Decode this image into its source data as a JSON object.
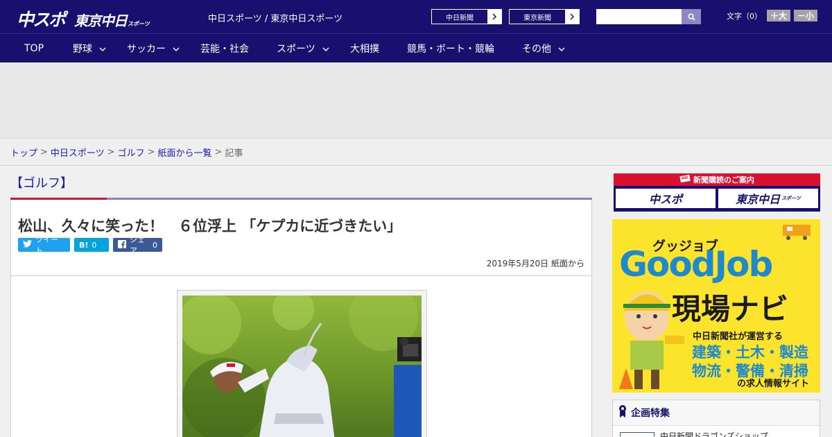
{
  "header": {
    "logo_main": "中スポ",
    "logo_sub": "東京中日",
    "logo_sub_small": "スポーツ",
    "site_name": "中日スポーツ / 東京中日スポーツ",
    "paper_links": [
      "中日新聞",
      "東京新聞"
    ],
    "search_placeholder": "",
    "font_label": "文字（0）",
    "font_larger": "＋大",
    "font_smaller": "－小"
  },
  "nav": {
    "items": [
      {
        "label": "TOP",
        "has_menu": false
      },
      {
        "label": "野球",
        "has_menu": true
      },
      {
        "label": "サッカー",
        "has_menu": true
      },
      {
        "label": "芸能・社会",
        "has_menu": false
      },
      {
        "label": "スポーツ",
        "has_menu": true
      },
      {
        "label": "大相撲",
        "has_menu": false
      },
      {
        "label": "競馬・ボート・競輪",
        "has_menu": false
      },
      {
        "label": "その他",
        "has_menu": true
      }
    ]
  },
  "breadcrumb": {
    "items": [
      "トップ",
      "中日スポーツ",
      "ゴルフ",
      "紙面から一覧"
    ],
    "current": "記事"
  },
  "article": {
    "category": "【ゴルフ】",
    "headline": "松山、久々に笑った！　６位浮上 「ケプカに近づきたい」",
    "tweet_label": "ツイート",
    "hatena_label": "B!",
    "hatena_count": "0",
    "facebook_label": "シェア",
    "facebook_count": "0",
    "date": "2019年5月20日 紙面から"
  },
  "sidebar": {
    "subscribe_title": "新聞購読のご案内",
    "subscribe_logo1": "中スポ",
    "subscribe_logo2": "東京中日",
    "subscribe_logo2_small": "スポーツ",
    "job_ad": {
      "kana": "グッジョブ",
      "title": "GoodJob",
      "subtitle": "現場ナビ",
      "line1": "中日新聞社が運営する",
      "line2": "建築・土木・製造",
      "line3": "物流・警備・清掃",
      "line4": "の求人情報サイト"
    },
    "kikaku_title": "企画特集",
    "kikaku_first": "中日新聞ドラゴンズショップ"
  },
  "colors": {
    "brand_navy": "#17106e",
    "accent_red": "#d01a2c",
    "link_blue": "#1b1bb0",
    "twitter": "#1da1f2",
    "hatena": "#00a4de",
    "facebook": "#3b5998",
    "job_yellow": "#fbe42b"
  }
}
